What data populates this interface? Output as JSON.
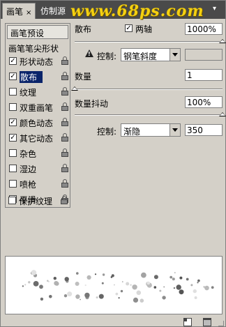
{
  "tabs": [
    {
      "label": "画笔"
    },
    {
      "label": "仿制源"
    }
  ],
  "tab_close": "×",
  "watermark": "www.68ps.com",
  "presets_button": "画笔预设",
  "section_title": "画笔笔尖形状",
  "options": [
    {
      "label": "形状动态",
      "checked": "✓",
      "locked": true
    },
    {
      "label": "散布",
      "checked": "✓",
      "locked": true,
      "selected": true
    },
    {
      "label": "纹理",
      "checked": "",
      "locked": true
    },
    {
      "label": "双重画笔",
      "checked": "",
      "locked": true
    },
    {
      "label": "颜色动态",
      "checked": "✓",
      "locked": true
    },
    {
      "label": "其它动态",
      "checked": "✓",
      "locked": true
    },
    {
      "label": "杂色",
      "checked": "",
      "locked": true
    },
    {
      "label": "湿边",
      "checked": "",
      "locked": true
    },
    {
      "label": "喷枪",
      "checked": "",
      "locked": true
    },
    {
      "label": "平滑",
      "checked": "✓",
      "locked": true
    },
    {
      "label": "保护纹理",
      "checked": "",
      "locked": true
    }
  ],
  "scatter": {
    "label": "散布",
    "both_axes_label": "两轴",
    "both_axes_checked": "✓",
    "value": "1000%",
    "slider_level": 1.0,
    "control_label": "控制:",
    "control_value": "钢笔斜度",
    "control_extra": ""
  },
  "count": {
    "label": "数量",
    "value": "1",
    "slider_level": 0.0
  },
  "count_jitter": {
    "label": "数量抖动",
    "value": "100%",
    "slider_level": 1.0,
    "control_label": "控制:",
    "control_value": "渐隐",
    "control_extra": "350"
  },
  "icons": {
    "warning": "warning-icon",
    "lock": "lock-icon",
    "new_brush": "new-brush-icon",
    "trash": "trash-icon"
  }
}
